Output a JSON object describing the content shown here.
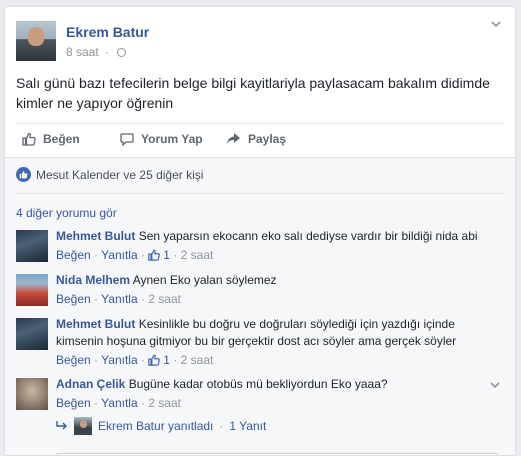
{
  "post": {
    "author": "Ekrem Batur",
    "time": "8 saat",
    "privacy_icon": "globe-icon",
    "text": "Salı günü bazı tefecilerin belge bilgi kayitlariyla paylasacam bakalım didimde kimler ne yapıyor öğrenin"
  },
  "actions": {
    "like": "Beğen",
    "comment": "Yorum Yap",
    "share": "Paylaş"
  },
  "likes_summary": "Mesut Kalender ve 25 diğer kişi",
  "more_comments": "4 diğer yorumu gör",
  "comments": [
    {
      "name": "Mehmet Bulut",
      "text": "Sen yaparsın ekocann eko salı dediyse vardır bir bildiği nida abi",
      "like": "Beğen",
      "reply": "Yanıtla",
      "likes_count": "1",
      "time": "2 saat"
    },
    {
      "name": "Nida Melhem",
      "text": "Aynen Eko yalan söylemez",
      "like": "Beğen",
      "reply": "Yanıtla",
      "time": "2 saat"
    },
    {
      "name": "Mehmet Bulut",
      "text": "Kesinlikle bu doğru ve doğruları söylediği için yazdığı içinde kimsenin hoşuna gitmiyor bu bir gerçektir dost acı söyler ama gerçek söyler",
      "like": "Beğen",
      "reply": "Yanıtla",
      "likes_count": "1",
      "time": "2 saat"
    },
    {
      "name": "Adnan Çelik",
      "text": "Bugüne kadar otobüs mü bekliyordun Eko yaaa?",
      "like": "Beğen",
      "reply": "Yanıtla",
      "time": "2 saat"
    }
  ],
  "reply_summary": {
    "text": "Ekrem Batur yanıtladı",
    "count": "1 Yanıt"
  },
  "colors": {
    "link": "#365899",
    "like_badge": "#4267b2",
    "muted": "#90949c"
  }
}
